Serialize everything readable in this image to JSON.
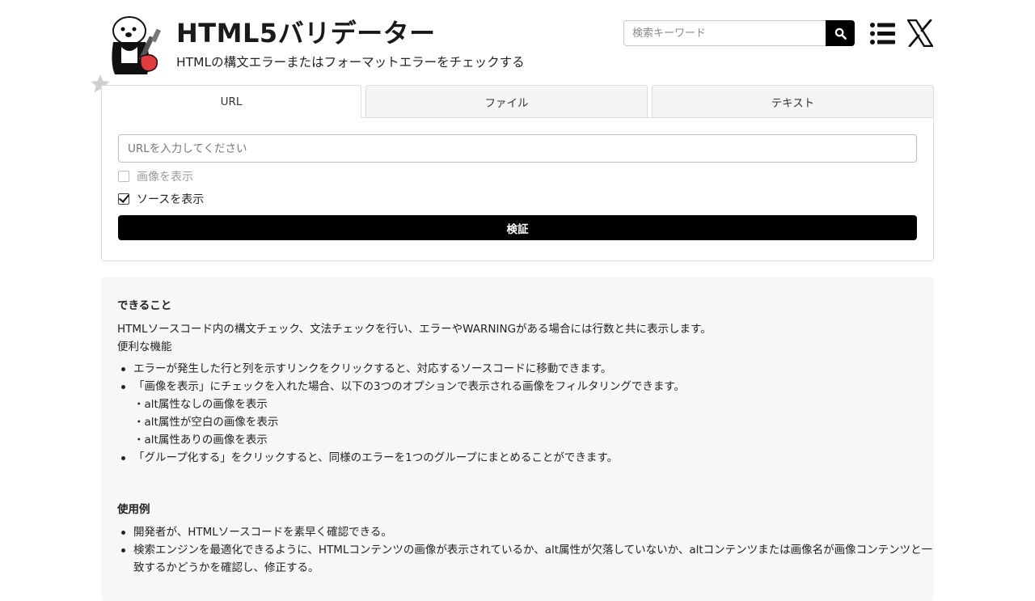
{
  "header": {
    "title": "HTML5バリデーター",
    "subtitle": "HTMLの構文エラーまたはフォーマットエラーをチェックする",
    "search_placeholder": "検索キーワード",
    "icons": [
      "search-icon",
      "menu-list-icon",
      "x-logo-icon",
      "star-icon",
      "otter-logo"
    ]
  },
  "tabs": [
    {
      "label": "URL",
      "active": true
    },
    {
      "label": "ファイル",
      "active": false
    },
    {
      "label": "テキスト",
      "active": false
    }
  ],
  "form": {
    "url_placeholder": "URLを入力してください",
    "show_images_label": "画像を表示",
    "show_images_checked": false,
    "show_source_label": "ソースを表示",
    "show_source_checked": true,
    "validate_label": "検証"
  },
  "info": {
    "can_do_heading": "できること",
    "can_do_text": "HTMLソースコード内の構文チェック、文法チェックを行い、エラーやWARNINGがある場合には行数と共に表示します。",
    "features_label": "便利な機能",
    "features": [
      "エラーが発生した行と列を示すリンクをクリックすると、対応するソースコードに移動できます。",
      "「画像を表示」にチェックを入れた場合、以下の3つのオプションで表示される画像をフィルタリングできます。"
    ],
    "image_options": [
      "・alt属性なしの画像を表示",
      "・alt属性が空白の画像を表示",
      "・alt属性ありの画像を表示"
    ],
    "feature_group": "「グループ化する」をクリックすると、同様のエラーを1つのグループにまとめることができます。",
    "usage_heading": "使用例",
    "usage": [
      "開発者が、HTMLソースコードを素早く確認できる。",
      "検索エンジンを最適化できるように、HTMLコンテンツの画像が表示されているか、alt属性が欠落していないか、altコンテンツまたは画像名が画像コンテンツと一致するかどうかを確認し、修正する。"
    ]
  },
  "colors": {
    "accent": "#000000",
    "panel_bg": "#f7f7f7",
    "tab_bg": "#f5f5f5",
    "border": "#dcdcdc"
  }
}
